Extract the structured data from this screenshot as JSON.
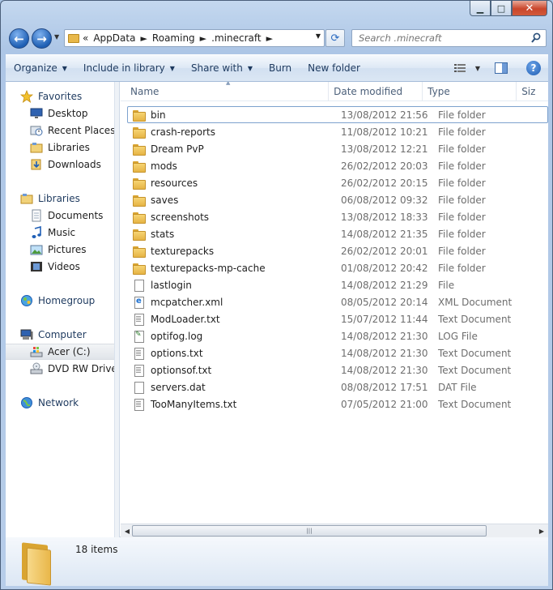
{
  "window": {
    "title": "",
    "controls": {
      "minimize": "▁",
      "maximize": "□",
      "close": "✕"
    }
  },
  "address": {
    "overflow": "«",
    "crumbs": [
      "AppData",
      "Roaming",
      ".minecraft"
    ],
    "separator": "►"
  },
  "search": {
    "placeholder": "Search .minecraft",
    "value": ""
  },
  "toolbar": {
    "items": [
      {
        "label": "Organize",
        "dropdown": true
      },
      {
        "label": "Include in library",
        "dropdown": true
      },
      {
        "label": "Share with",
        "dropdown": true
      },
      {
        "label": "Burn",
        "dropdown": false
      },
      {
        "label": "New folder",
        "dropdown": false
      }
    ]
  },
  "nav": {
    "items": [
      {
        "label": "Favorites",
        "icon": "star-icon",
        "group": true
      },
      {
        "label": "Desktop",
        "icon": "desktop-icon"
      },
      {
        "label": "Recent Places",
        "icon": "recent-places-icon"
      },
      {
        "label": "Libraries",
        "icon": "libraries-icon"
      },
      {
        "label": "Downloads",
        "icon": "downloads-icon"
      },
      {
        "label": "Libraries",
        "icon": "libraries-icon",
        "group": true
      },
      {
        "label": "Documents",
        "icon": "documents-icon"
      },
      {
        "label": "Music",
        "icon": "music-icon"
      },
      {
        "label": "Pictures",
        "icon": "pictures-icon"
      },
      {
        "label": "Videos",
        "icon": "videos-icon"
      },
      {
        "label": "Homegroup",
        "icon": "homegroup-icon",
        "group": true
      },
      {
        "label": "Computer",
        "icon": "computer-icon",
        "group": true
      },
      {
        "label": "Acer (C:)",
        "icon": "drive-icon",
        "selected": true
      },
      {
        "label": "DVD RW Drive (",
        "icon": "dvd-drive-icon"
      },
      {
        "label": "Network",
        "icon": "network-icon",
        "group": true
      }
    ]
  },
  "columns": {
    "name": "Name",
    "date": "Date modified",
    "type": "Type",
    "size": "Siz"
  },
  "files": [
    {
      "name": "bin",
      "date": "13/08/2012 21:56",
      "type": "File folder",
      "kind": "folder",
      "selected": true
    },
    {
      "name": "crash-reports",
      "date": "11/08/2012 10:21",
      "type": "File folder",
      "kind": "folder"
    },
    {
      "name": "Dream PvP",
      "date": "13/08/2012 12:21",
      "type": "File folder",
      "kind": "folder"
    },
    {
      "name": "mods",
      "date": "26/02/2012 20:03",
      "type": "File folder",
      "kind": "folder"
    },
    {
      "name": "resources",
      "date": "26/02/2012 20:15",
      "type": "File folder",
      "kind": "folder"
    },
    {
      "name": "saves",
      "date": "06/08/2012 09:32",
      "type": "File folder",
      "kind": "folder"
    },
    {
      "name": "screenshots",
      "date": "13/08/2012 18:33",
      "type": "File folder",
      "kind": "folder"
    },
    {
      "name": "stats",
      "date": "14/08/2012 21:35",
      "type": "File folder",
      "kind": "folder"
    },
    {
      "name": "texturepacks",
      "date": "26/02/2012 20:01",
      "type": "File folder",
      "kind": "folder"
    },
    {
      "name": "texturepacks-mp-cache",
      "date": "01/08/2012 20:42",
      "type": "File folder",
      "kind": "folder"
    },
    {
      "name": "lastlogin",
      "date": "14/08/2012 21:29",
      "type": "File",
      "kind": "file"
    },
    {
      "name": "mcpatcher.xml",
      "date": "08/05/2012 20:14",
      "type": "XML Document",
      "kind": "xml"
    },
    {
      "name": "ModLoader.txt",
      "date": "15/07/2012 11:44",
      "type": "Text Document",
      "kind": "txt"
    },
    {
      "name": "optifog.log",
      "date": "14/08/2012 21:30",
      "type": "LOG File",
      "kind": "log"
    },
    {
      "name": "options.txt",
      "date": "14/08/2012 21:30",
      "type": "Text Document",
      "kind": "txt"
    },
    {
      "name": "optionsof.txt",
      "date": "14/08/2012 21:30",
      "type": "Text Document",
      "kind": "txt"
    },
    {
      "name": "servers.dat",
      "date": "08/08/2012 17:51",
      "type": "DAT File",
      "kind": "file"
    },
    {
      "name": "TooManyItems.txt",
      "date": "07/05/2012 21:00",
      "type": "Text Document",
      "kind": "txt"
    }
  ],
  "status": {
    "item_count": "18 items"
  },
  "colors": {
    "folder": "#e6b445",
    "selection_border": "#7da2ce",
    "chrome": "#b7cde9",
    "link_text": "#1e3a5f"
  }
}
